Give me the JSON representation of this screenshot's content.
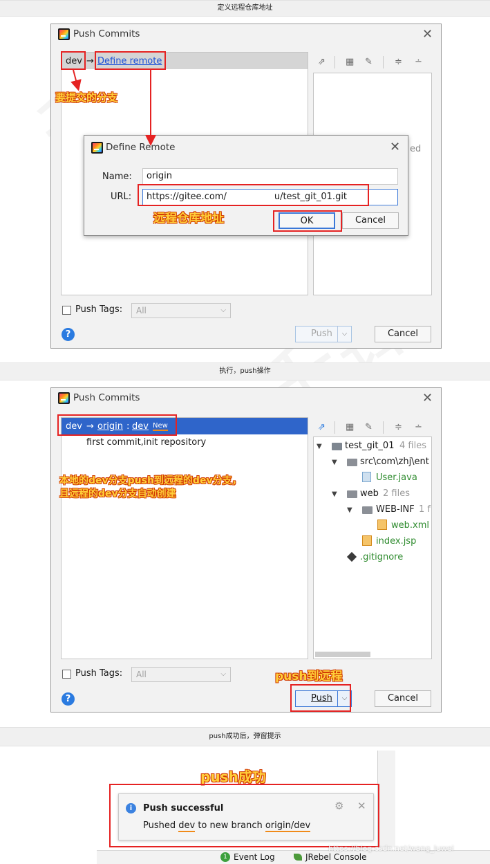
{
  "sections": [
    {
      "header": "定义远程仓库地址"
    },
    {
      "header": "执行，push操作"
    },
    {
      "header": "push成功后，弹窗提示"
    }
  ],
  "dialog": {
    "title": "Push Commits",
    "push_tags_label": "Push Tags:",
    "tags_value": "All",
    "push_label": "Push",
    "cancel_label": "Cancel",
    "help": "?"
  },
  "step1": {
    "branch": "dev",
    "arrow": "→",
    "define_remote": "Define remote",
    "annotation": "要提交的分支",
    "partial_text": "ed",
    "define_remote_dialog": {
      "title": "Define Remote",
      "name_label": "Name:",
      "name_value": "origin",
      "url_label": "URL:",
      "url_value_start": "https://gitee.com/",
      "url_value_end": "u/test_git_01.git",
      "ok_label": "OK",
      "cancel_label": "Cancel",
      "annotation": "远程仓库地址"
    }
  },
  "step2": {
    "branch_row": {
      "local": "dev",
      "arrow": "→",
      "remote": "origin",
      "sep": ":",
      "target": "dev",
      "badge": "New"
    },
    "commit": "first commit,init repository",
    "annotation_line1": "本地的dev分支push到远程的dev分支，",
    "annotation_line2": "且远程的dev分支自动创建",
    "push_annotation": "push到远程",
    "tree": [
      {
        "label": "test_git_01",
        "meta": "4 files"
      },
      {
        "label": "src\\com\\zhj\\ent",
        "meta": ""
      },
      {
        "label": "User.java",
        "meta": ""
      },
      {
        "label": "web",
        "meta": "2 files"
      },
      {
        "label": "WEB-INF",
        "meta": "1 f"
      },
      {
        "label": "web.xml",
        "meta": ""
      },
      {
        "label": "index.jsp",
        "meta": ""
      },
      {
        "label": ".gitignore",
        "meta": ""
      }
    ]
  },
  "step3": {
    "annotation": "push成功",
    "title": "Push successful",
    "msg_prefix": "Pushed ",
    "msg_branch": "dev",
    "msg_middle": " to new branch ",
    "msg_remote": "origin/dev",
    "event_log": "Event Log",
    "jrebel": "JRebel Console",
    "watermark_url": "https://blog.csdn.net/wang_luwei"
  },
  "colors": {
    "accent": "#2f65ca",
    "annotation": "#ffcf3a",
    "highlight": "#e52222",
    "file_green": "#2e8b2e"
  }
}
